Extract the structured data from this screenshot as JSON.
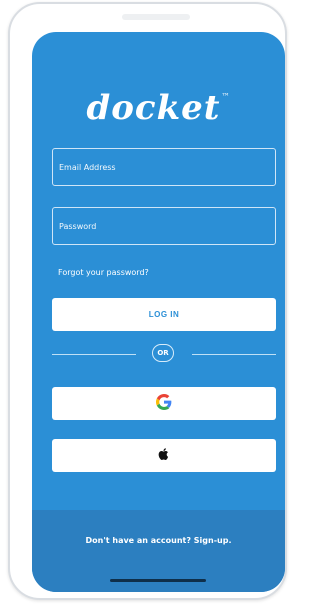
{
  "app": {
    "logo_text": "docket",
    "logo_mark": "™"
  },
  "form": {
    "email_placeholder": "Email Address",
    "password_placeholder": "Password",
    "forgot_password": "Forgot your password?",
    "login_label": "LOG IN",
    "divider_label": "OR"
  },
  "social": {
    "google_icon": "google-icon",
    "apple_icon": "apple-icon"
  },
  "footer": {
    "signup_text": "Don't have an account? Sign-up."
  },
  "colors": {
    "primary": "#2b8fd6",
    "footer": "#2c7fc0",
    "white": "#ffffff"
  }
}
